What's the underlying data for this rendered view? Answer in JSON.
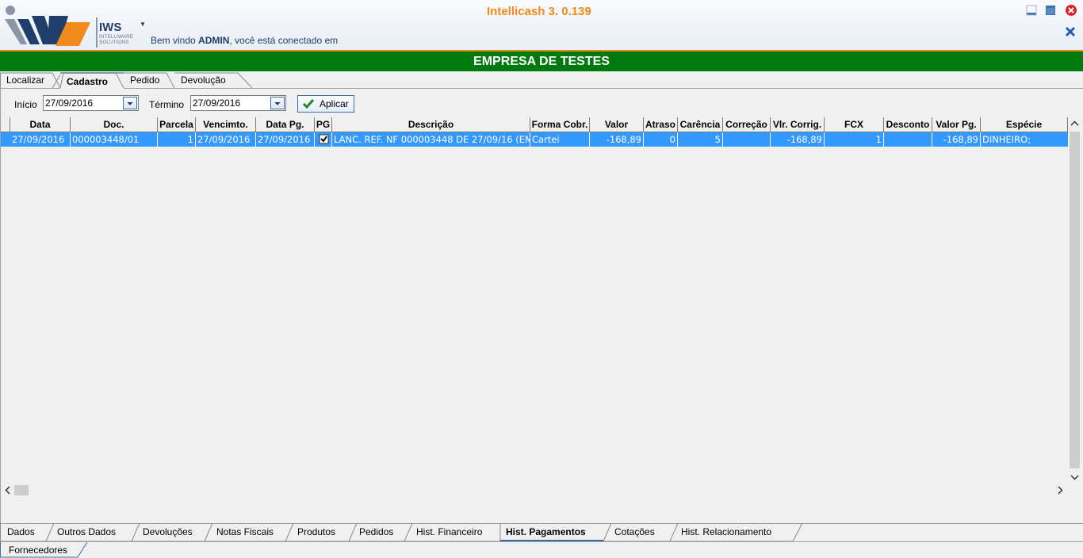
{
  "app": {
    "title": "Intellicash 3. 0.139",
    "logo_text": "IWS",
    "logo_sub": "INTELLIWARE SOLUTIONS",
    "welcome_prefix": "Bem vindo",
    "welcome_user": "ADMIN",
    "welcome_suffix": ", você está conectado em"
  },
  "company": "EMPRESA DE TESTES",
  "top_tabs": [
    "Localizar",
    "Cadastro",
    "Pedido",
    "Devolução"
  ],
  "active_top_tab": "Cadastro",
  "filter": {
    "inicio_label": "Início",
    "inicio_value": "27/09/2016",
    "termino_label": "Término",
    "termino_value": "27/09/2016",
    "apply_label": "Aplicar"
  },
  "grid": {
    "columns": [
      "Data",
      "Doc.",
      "Parcela",
      "Vencimto.",
      "Data Pg.",
      "PG",
      "Descrição",
      "Forma Cobr.",
      "Valor",
      "Atraso",
      "Carência",
      "Correção",
      "Vlr. Corrig.",
      "FCX",
      "Desconto",
      "Valor Pg.",
      "Espécie"
    ],
    "rows": [
      {
        "data": "27/09/2016",
        "doc": "000003448/01",
        "parcela": "1",
        "vencimento": "27/09/2016",
        "data_pg": "27/09/2016",
        "pg": true,
        "descricao": "LANC. REF. NF 000003448 DE 27/09/16 (EM",
        "forma_cobr": "Cartei",
        "valor": "-168,89",
        "atraso": "0",
        "carencia": "5",
        "correcao": "",
        "vlr_corrig": "-168,89",
        "fcx": "1",
        "desconto": "",
        "valor_pg": "-168,89",
        "especie": "DINHEIRO;"
      }
    ]
  },
  "bottom_tabs": [
    "Dados",
    "Outros Dados",
    "Devoluções",
    "Notas Fiscais",
    "Produtos",
    "Pedidos",
    "Hist. Financeiro",
    "Hist. Pagamentos",
    "Cotações",
    "Hist. Relacionamento"
  ],
  "active_bottom_tab": "Hist. Pagamentos",
  "footer_tab": "Fornecedores",
  "colors": {
    "title_orange": "#f08a1c",
    "company_bar_green": "#007a0e",
    "selection_blue": "#3399ff"
  }
}
